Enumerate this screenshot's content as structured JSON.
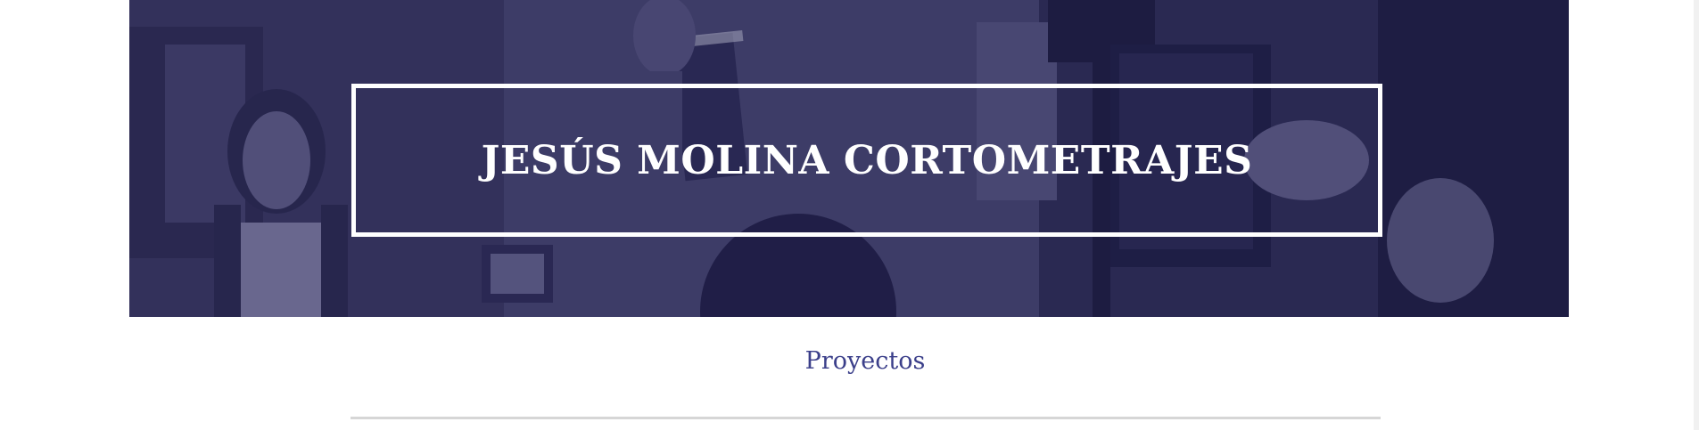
{
  "hero": {
    "title": "JESÚS MOLINA CORTOMETRAJES",
    "overlay_color": "#3f3d66"
  },
  "nav": {
    "projects_label": "Proyectos",
    "link_color": "#3b3f8a"
  }
}
